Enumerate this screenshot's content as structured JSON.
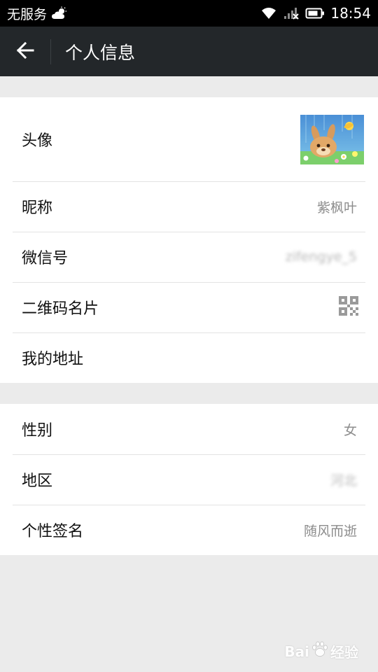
{
  "status_bar": {
    "carrier": "无服务",
    "weather_icon": "cloud-sun-icon",
    "wifi_icon": "wifi-icon",
    "signal_icon": "signal-off-icon",
    "battery_icon": "battery-icon",
    "time": "18:54"
  },
  "header": {
    "back_icon": "arrow-left-icon",
    "title": "个人信息"
  },
  "profile_rows": [
    {
      "label": "头像",
      "value": "",
      "type": "avatar"
    },
    {
      "label": "昵称",
      "value": "紫枫叶"
    },
    {
      "label": "微信号",
      "value": "zifengye_5",
      "blurred": true
    },
    {
      "label": "二维码名片",
      "value": "",
      "icon": "qr-code-icon"
    },
    {
      "label": "我的地址",
      "value": ""
    }
  ],
  "detail_rows": [
    {
      "label": "性别",
      "value": "女"
    },
    {
      "label": "地区",
      "value": "河北",
      "blurred": true
    },
    {
      "label": "个性签名",
      "value": "随风而逝"
    }
  ],
  "watermark": {
    "text_left": "Bai",
    "text_right": "经验",
    "icon": "paw-icon"
  },
  "colors": {
    "status_bar_bg": "#000000",
    "title_bar_bg": "#23272a",
    "page_bg": "#ebebeb",
    "row_bg": "#ffffff",
    "label_color": "#111111",
    "value_color": "#8c8c8c",
    "divider": "#e3e3e3"
  }
}
